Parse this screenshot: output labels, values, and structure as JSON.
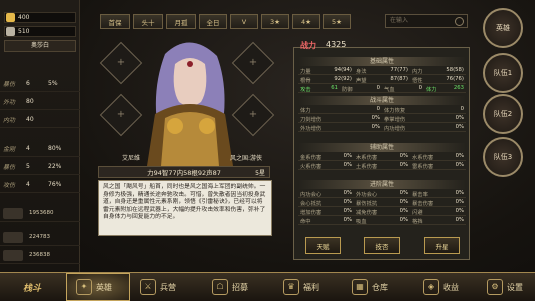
{
  "resources": [
    {
      "label": "400",
      "color": "#e4b84a"
    },
    {
      "label": "510",
      "color": "#b9b2a2"
    }
  ],
  "hero_selected": "奥莎白",
  "left_stats": [
    {
      "k": "暴伤",
      "v": "6",
      "b": "5%"
    },
    {
      "k": "外功",
      "v": "80",
      "b": ""
    },
    {
      "k": "内功",
      "v": "40",
      "b": ""
    },
    {
      "k": "金刚",
      "v": "4",
      "b": "80%"
    },
    {
      "k": "暴伤",
      "v": "5",
      "b": "22%"
    },
    {
      "k": "攻伤",
      "v": "4",
      "b": "76%"
    }
  ],
  "left_money": [
    "1953680",
    "224783",
    "236838"
  ],
  "tabs": [
    "首保",
    "头十",
    "月孤",
    "全日",
    "V",
    "3★",
    "4★",
    "5★"
  ],
  "search_placeholder": "在输入",
  "hero": {
    "name": "艾尼维",
    "faction": "风之国:游侠",
    "power_line": "力94智77内58根92声87",
    "stars": "5星",
    "story": "风之国「飓风号」船首，同时也是风之国海上军团的副统帅。一身修为极强，精通长途奔驰攻击。可惜，曾失散者因当初投身武道，自身还是重属性元素系刚，领悟《引雷秘诀》，已经可以将雷元素附加在远程武器上，大幅的提升攻击效率和伤害，弥补了自身体力与回复能力的不足。"
  },
  "panel": {
    "power_label": "战力",
    "power_value": "4325",
    "sections": [
      "基础属性",
      "战斗属性",
      "辅助属性",
      "进阶属性"
    ],
    "basic": [
      [
        {
          "n": "力量",
          "w": "94(94)"
        },
        {
          "n": "身法",
          "w": "77(77)"
        },
        {
          "n": "内力",
          "w": "58(58)"
        }
      ],
      [
        {
          "n": "根骨",
          "w": "92(92)"
        },
        {
          "n": "声望",
          "w": "87(87)"
        },
        {
          "n": "悟性",
          "w": "76(76)"
        }
      ],
      [
        {
          "n": "攻击",
          "w": "61",
          "g": true
        },
        {
          "n": "防御",
          "w": "0"
        },
        {
          "n": "气血",
          "w": "0"
        },
        {
          "n": "体力",
          "w": "263",
          "g": true
        }
      ]
    ],
    "battle": [
      [
        {
          "n": "体力",
          "w": "0"
        },
        {
          "n": "体力恢复",
          "w": "0"
        }
      ],
      [
        {
          "n": "刀剑增伤",
          "w": "0%"
        },
        {
          "n": "拳掌增伤",
          "w": "0%"
        }
      ],
      [
        {
          "n": "外功增伤",
          "w": "0%"
        },
        {
          "n": "内功增伤",
          "w": "0%"
        }
      ]
    ],
    "aux": [
      [
        {
          "n": "金系伤害",
          "w": "0%"
        },
        {
          "n": "木系伤害",
          "w": "0%"
        },
        {
          "n": "水系伤害",
          "w": "0%"
        }
      ],
      [
        {
          "n": "火系伤害",
          "w": "0%"
        },
        {
          "n": "土系伤害",
          "w": "0%"
        },
        {
          "n": "雷系伤害",
          "w": "0%"
        }
      ]
    ],
    "adv": [
      [
        {
          "n": "内功会心",
          "w": "0%"
        },
        {
          "n": "外功会心",
          "w": "0%"
        },
        {
          "n": "暴击率",
          "w": "0%"
        }
      ],
      [
        {
          "n": "会心抵抗",
          "w": "0%"
        },
        {
          "n": "暴伤抵抗",
          "w": "0%"
        },
        {
          "n": "暴击伤害",
          "w": "0%"
        }
      ],
      [
        {
          "n": "增加伤害",
          "w": "0%"
        },
        {
          "n": "减免伤害",
          "w": "0%"
        },
        {
          "n": "闪避",
          "w": "0%"
        }
      ],
      [
        {
          "n": "命中",
          "w": "0%"
        },
        {
          "n": "吸血",
          "w": "0%"
        },
        {
          "n": "格挡",
          "w": "0%"
        }
      ]
    ]
  },
  "buttons": [
    "天赋",
    "技否",
    "升星"
  ],
  "side": [
    "英雄",
    "队伍1",
    "队伍2",
    "队伍3"
  ],
  "logo": "栈斗",
  "nav": [
    {
      "l": "英雄",
      "i": "✦"
    },
    {
      "l": "兵营",
      "i": "⚔"
    },
    {
      "l": "招募",
      "i": "☖"
    },
    {
      "l": "福利",
      "i": "♛"
    },
    {
      "l": "仓库",
      "i": "▦"
    },
    {
      "l": "收益",
      "i": "◈"
    },
    {
      "l": "设置",
      "i": "⚙"
    }
  ]
}
